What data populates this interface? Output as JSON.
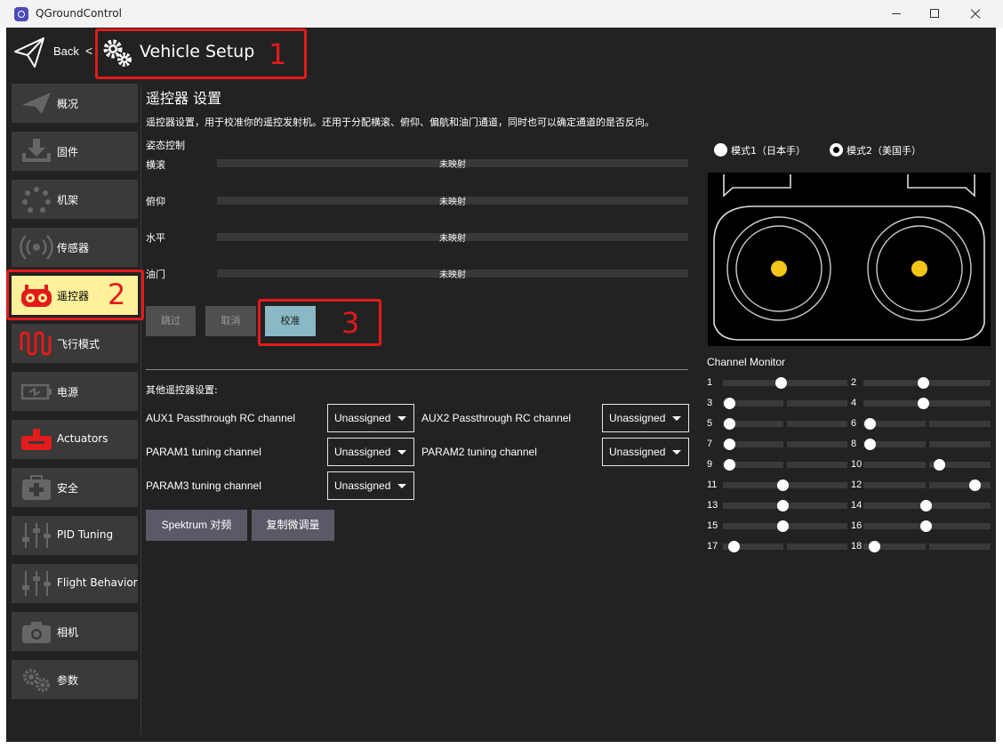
{
  "window": {
    "title": "QGroundControl"
  },
  "header": {
    "back_label": "Back",
    "back_sep": "<",
    "title": "Vehicle Setup"
  },
  "annotations": [
    "1",
    "2",
    "3"
  ],
  "annotation_color": "#e21b1b",
  "sidebar": {
    "active_color": "#fff29a",
    "items": [
      {
        "label": "概况",
        "icon": "plane-icon"
      },
      {
        "label": "固件",
        "icon": "download-icon"
      },
      {
        "label": "机架",
        "icon": "frame-dots-icon"
      },
      {
        "label": "传感器",
        "icon": "radio-waves-icon"
      },
      {
        "label": "遥控器",
        "icon": "remote-control-icon"
      },
      {
        "label": "飞行模式",
        "icon": "waveform-icon"
      },
      {
        "label": "电源",
        "icon": "battery-icon"
      },
      {
        "label": "Actuators",
        "icon": "actuator-icon"
      },
      {
        "label": "安全",
        "icon": "first-aid-icon"
      },
      {
        "label": "PID Tuning",
        "icon": "sliders-icon"
      },
      {
        "label": "Flight Behavior",
        "icon": "sliders-icon"
      },
      {
        "label": "相机",
        "icon": "camera-icon"
      },
      {
        "label": "参数",
        "icon": "gears-icon"
      }
    ]
  },
  "rc": {
    "title": "遥控器 设置",
    "description": "遥控器设置，用于校准你的遥控发射机。还用于分配横滚、俯仰、偏航和油门通道，同时也可以确定通道的是否反向。",
    "attitude_heading": "姿态控制",
    "axes": [
      {
        "label": "横滚",
        "value": "未映射"
      },
      {
        "label": "俯仰",
        "value": "未映射"
      },
      {
        "label": "水平",
        "value": "未映射"
      },
      {
        "label": "油门",
        "value": "未映射"
      }
    ],
    "buttons": {
      "skip": "跳过",
      "cancel": "取消",
      "calibrate": "校准"
    },
    "calibrate_color": "#8ab8c5"
  },
  "other": {
    "heading": "其他遥控器设置:",
    "params": [
      {
        "label": "AUX1 Passthrough RC channel",
        "value": "Unassigned"
      },
      {
        "label": "AUX2 Passthrough RC channel",
        "value": "Unassigned"
      },
      {
        "label": "PARAM1 tuning channel",
        "value": "Unassigned"
      },
      {
        "label": "PARAM2 tuning channel",
        "value": "Unassigned"
      },
      {
        "label": "PARAM3 tuning channel",
        "value": "Unassigned"
      }
    ],
    "spektrum_label": "Spektrum 对频",
    "copy_trims_label": "复制微调量"
  },
  "mode": {
    "mode1": "模式1（日本手）",
    "mode2": "模式2（美国手）",
    "selected": 2
  },
  "stick_color": "#f5c518",
  "channel_monitor": {
    "title": "Channel Monitor",
    "channels": [
      {
        "n": "1",
        "pos": 0.47
      },
      {
        "n": "2",
        "pos": 0.47
      },
      {
        "n": "3",
        "pos": 0.05
      },
      {
        "n": "4",
        "pos": 0.47
      },
      {
        "n": "5",
        "pos": 0.05
      },
      {
        "n": "6",
        "pos": 0.05
      },
      {
        "n": "7",
        "pos": 0.05
      },
      {
        "n": "8",
        "pos": 0.05
      },
      {
        "n": "9",
        "pos": 0.05
      },
      {
        "n": "10",
        "pos": 0.6
      },
      {
        "n": "11",
        "pos": 0.48
      },
      {
        "n": "12",
        "pos": 0.88
      },
      {
        "n": "13",
        "pos": 0.48
      },
      {
        "n": "14",
        "pos": 0.49
      },
      {
        "n": "15",
        "pos": 0.48
      },
      {
        "n": "16",
        "pos": 0.49
      },
      {
        "n": "17",
        "pos": 0.09
      },
      {
        "n": "18",
        "pos": 0.09
      }
    ]
  }
}
